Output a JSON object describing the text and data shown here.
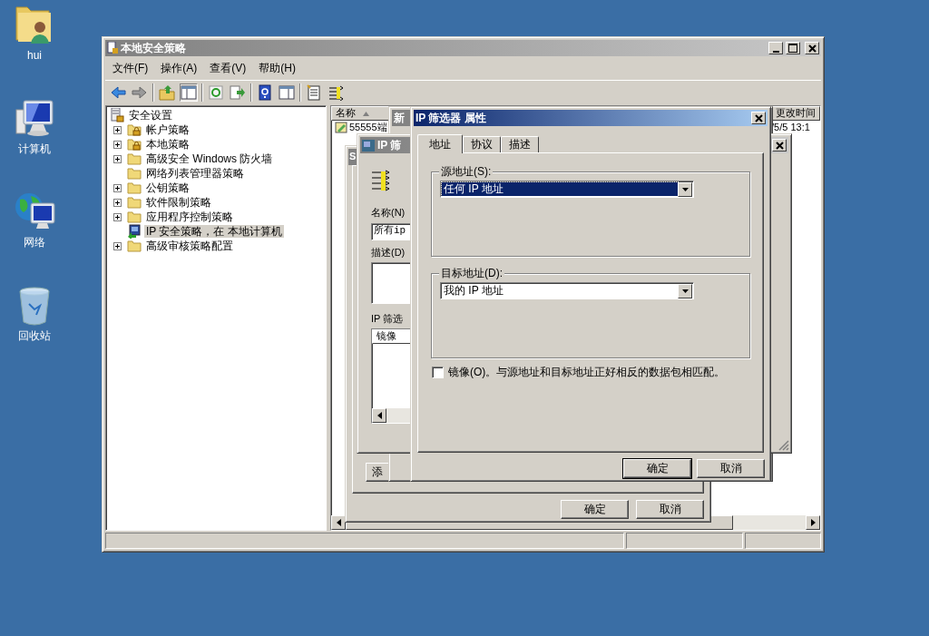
{
  "desktop_icons": [
    {
      "label": "hui",
      "kind": "user-folder"
    },
    {
      "label": "计算机",
      "kind": "computer"
    },
    {
      "label": "网络",
      "kind": "network"
    },
    {
      "label": "回收站",
      "kind": "recycle-bin"
    }
  ],
  "main_window": {
    "title": "本地安全策略",
    "menu": [
      "文件(F)",
      "操作(A)",
      "查看(V)",
      "帮助(H)"
    ],
    "tree": {
      "label": "安全设置",
      "children": [
        {
          "label": "帐户策略",
          "kind": "locked-folder",
          "expandable": true,
          "selected": false
        },
        {
          "label": "本地策略",
          "kind": "locked-folder",
          "expandable": true,
          "selected": false
        },
        {
          "label": "高级安全 Windows 防火墙",
          "kind": "folder",
          "expandable": true,
          "selected": false
        },
        {
          "label": "网络列表管理器策略",
          "kind": "folder",
          "expandable": false,
          "selected": false
        },
        {
          "label": "公钥策略",
          "kind": "folder",
          "expandable": true,
          "selected": false
        },
        {
          "label": "软件限制策略",
          "kind": "folder",
          "expandable": true,
          "selected": false
        },
        {
          "label": "应用程序控制策略",
          "kind": "folder",
          "expandable": true,
          "selected": false
        },
        {
          "label": "IP 安全策略，在 本地计算机",
          "kind": "ip-policy",
          "expandable": false,
          "selected": true
        },
        {
          "label": "高级审核策略配置",
          "kind": "folder",
          "expandable": true,
          "selected": false
        }
      ]
    },
    "list": {
      "columns": [
        {
          "label": "名称",
          "sorted": true
        },
        {
          "label": "更改时间",
          "sorted": false
        }
      ],
      "rows": [
        {
          "cells": [
            "55555端",
            "/5/5 13:1"
          ]
        }
      ]
    }
  },
  "rule_list_dialog": {
    "title": "S",
    "add_button": "添",
    "buttons": [
      "确定",
      "取消"
    ]
  },
  "rule_dialog": {
    "title": "新"
  },
  "filter_list_dialog": {
    "title": "IP 筛",
    "name_label": "名称(N)",
    "name_value": "所有ip",
    "description_label": "描述(D)",
    "list_label": "IP 筛选",
    "list_columns": [
      "镜像"
    ]
  },
  "filter_properties_dialog": {
    "title": "IP 筛选器 属性",
    "tabs": [
      {
        "label": "地址",
        "selected": true
      },
      {
        "label": "协议",
        "selected": false
      },
      {
        "label": "描述",
        "selected": false
      }
    ],
    "source": {
      "label": "源地址(S):",
      "value": "任何 IP 地址",
      "highlighted": true
    },
    "destination": {
      "label": "目标地址(D):",
      "value": "我的 IP 地址",
      "highlighted": false
    },
    "mirror": {
      "label": "镜像(O)。与源地址和目标地址正好相反的数据包相匹配。",
      "checked": false
    },
    "buttons": [
      {
        "label": "确定",
        "default": true
      },
      {
        "label": "取消",
        "default": false
      }
    ]
  }
}
